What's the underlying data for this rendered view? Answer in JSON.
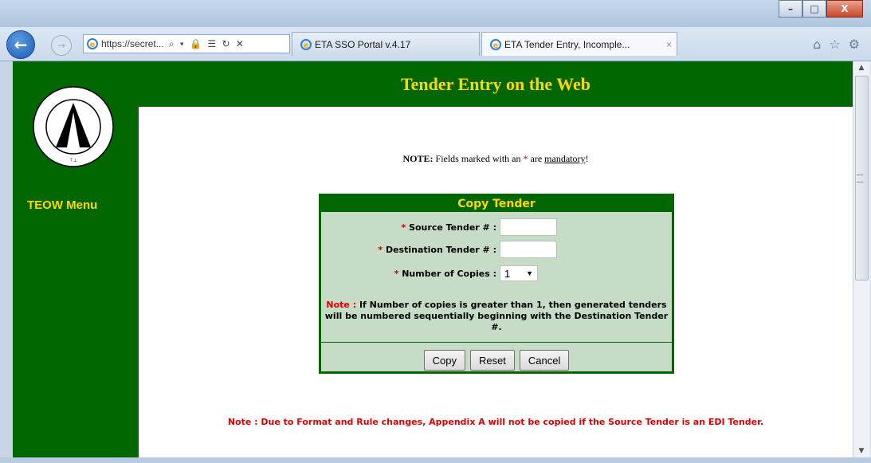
{
  "browser": {
    "address_url": "https://secret...",
    "address_tools": "⌕ ▾ 🔒 ☰ ↻ ✕",
    "tabs": [
      {
        "label": "ETA SSO Portal v.4.17",
        "active": false
      },
      {
        "label": "ETA Tender Entry, Incomple...",
        "active": true
      }
    ],
    "tab_close": "×",
    "window_buttons": {
      "minimize": "–",
      "maximize": "□",
      "close": "X"
    },
    "icons": [
      "home-icon",
      "favorites-star-icon",
      "settings-gear-icon"
    ]
  },
  "sidebar": {
    "menu_title": "TEOW Menu",
    "logo_text": "MILITARY SURFACE DEPLOYMENT AND DISTRIBUTION COMMAND"
  },
  "header": {
    "title": "Tender Entry on the Web"
  },
  "mandatory_note": {
    "prefix": "NOTE:",
    "text_before": " Fields marked with an ",
    "star": "*",
    "text_after": " are ",
    "emph": "mandatory",
    "end": "!"
  },
  "copy_tender": {
    "title": "Copy Tender",
    "source_label": "Source Tender # :",
    "source_value": "",
    "destination_label": "Destination Tender # :",
    "destination_value": "",
    "copies_label": "Number of Copies :",
    "copies_value": "1",
    "required_mark": "*",
    "note_prefix": "Note :",
    "note_text": " If Number of copies is greater than 1, then generated tenders will be numbered sequentially beginning with the Destination Tender #.",
    "buttons": {
      "copy": "Copy",
      "reset": "Reset",
      "cancel": "Cancel"
    }
  },
  "edi_note": "Note : Due to Format and Rule changes, Appendix A will not be copied if the Source Tender is an EDI Tender.",
  "colors": {
    "brand_green": "#006600",
    "gold": "#ffd700",
    "panel_bg": "#c7dcc7",
    "warning_red": "#e00000"
  }
}
